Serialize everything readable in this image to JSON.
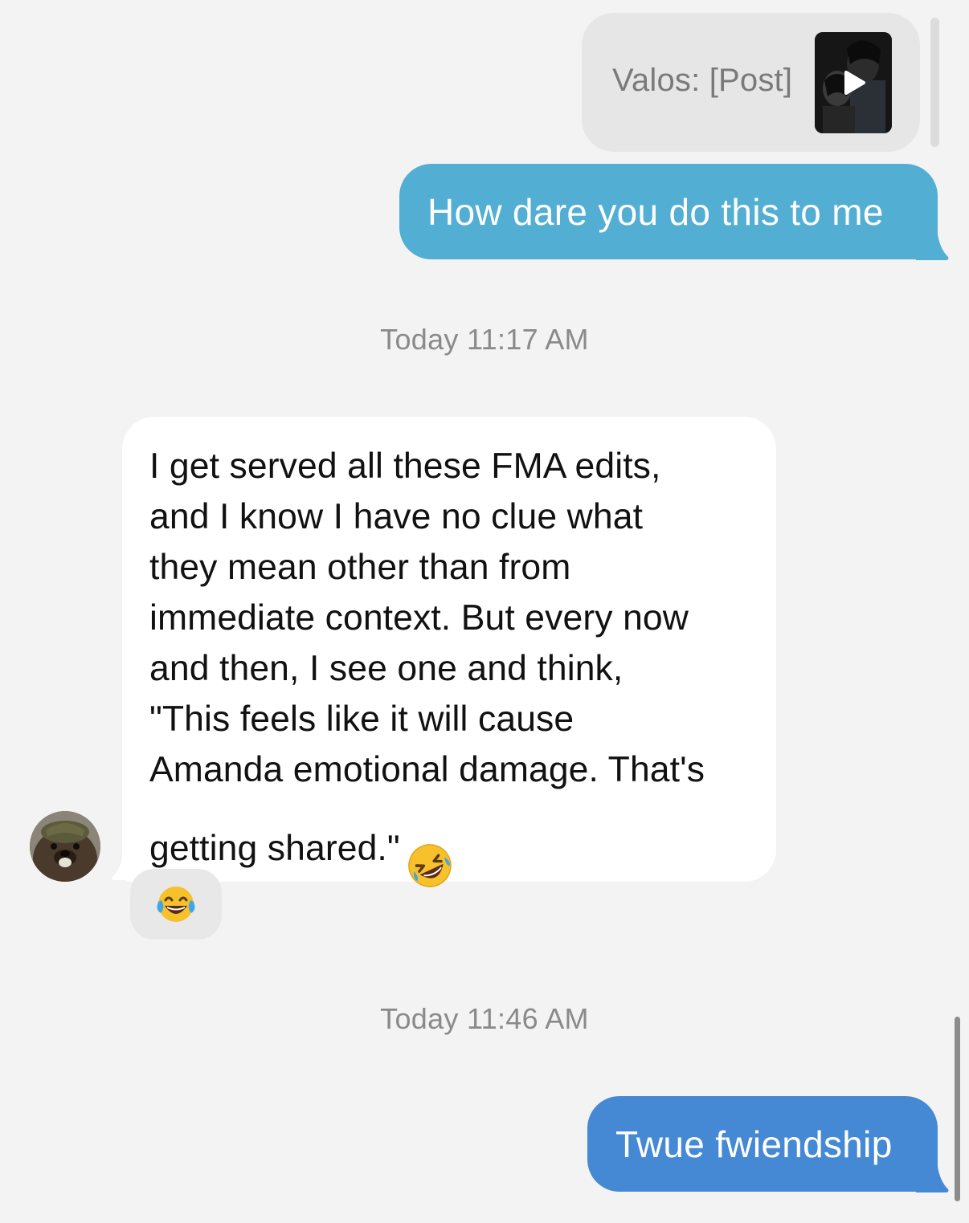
{
  "quoted_post": {
    "label": "Valos: [Post]",
    "thumbnail_icon": "video-thumbnail",
    "play_icon": "play-icon"
  },
  "messages": [
    {
      "direction": "outgoing",
      "text": "How dare you do this to me",
      "color": "#53aed3"
    },
    {
      "direction": "incoming",
      "text": "I get served all these FMA edits,\nand I know I have no clue what\nthey mean other than from\nimmediate context. But every now\nand then, I see one and think,\n\"This feels like it will cause\nAmanda emotional damage. That's\ngetting shared.\"",
      "emoji": "rolling-on-floor-laughing-emoji",
      "reaction": "face-with-tears-of-joy-emoji"
    },
    {
      "direction": "outgoing",
      "text": "Twue fwiendship",
      "color": "#4589d4"
    }
  ],
  "timestamps": [
    "Today 11:17 AM",
    "Today 11:46 AM"
  ]
}
